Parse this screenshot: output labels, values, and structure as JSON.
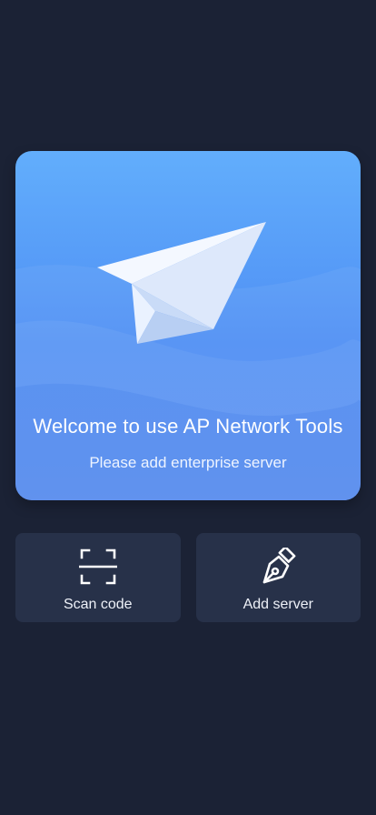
{
  "hero": {
    "illustration": "paper-plane-icon",
    "title": "Welcome to use AP Network Tools",
    "subtitle": "Please add enterprise server"
  },
  "actions": [
    {
      "label": "Scan code",
      "icon": "scan-icon"
    },
    {
      "label": "Add server",
      "icon": "pen-icon"
    }
  ],
  "colors": {
    "background": "#1b2235",
    "card": "#273149",
    "hero_top": "#62aefc",
    "hero_bottom": "#5a8ef1"
  }
}
